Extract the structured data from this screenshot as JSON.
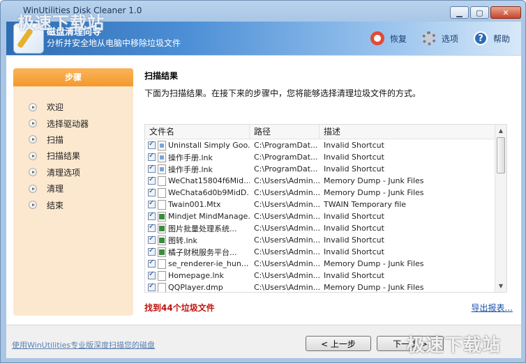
{
  "window": {
    "title": "WinUtilities Disk Cleaner 1.0"
  },
  "banner": {
    "title": "磁盘清理向导",
    "subtitle": "分析并安全地从电脑中移除垃圾文件",
    "actions": [
      {
        "label": "恢复",
        "icon": "lifebuoy-icon"
      },
      {
        "label": "选项",
        "icon": "gear-icon"
      },
      {
        "label": "帮助",
        "icon": "help-icon"
      }
    ]
  },
  "sidebar": {
    "title": "步骤",
    "steps": [
      "欢迎",
      "选择驱动器",
      "扫描",
      "扫描结果",
      "清理选项",
      "清理",
      "结束"
    ]
  },
  "main": {
    "title": "扫描结果",
    "description": "下面为扫描结果。在接下来的步骤中，您将能够选择清理垃圾文件的方式。",
    "columns": [
      "文件名",
      "路径",
      "描述"
    ],
    "rows": [
      [
        "Uninstall Simply Goo...",
        "C:\\ProgramDat...",
        "Invalid Shortcut"
      ],
      [
        "操作手册.lnk",
        "C:\\ProgramDat...",
        "Invalid Shortcut"
      ],
      [
        "操作手册.lnk",
        "C:\\ProgramDat...",
        "Invalid Shortcut"
      ],
      [
        "WeChat15804f6Mid...",
        "C:\\Users\\Admin...",
        "Memory Dump - Junk Files"
      ],
      [
        "WeChata6d0b9MidD...",
        "C:\\Users\\Admin...",
        "Memory Dump - Junk Files"
      ],
      [
        "Twain001.Mtx",
        "C:\\Users\\Admin...",
        "TWAIN Temporary file"
      ],
      [
        "Mindjet MindManage...",
        "C:\\Users\\Admin...",
        "Invalid Shortcut"
      ],
      [
        "图片批量处理系统...",
        "C:\\Users\\Admin...",
        "Invalid Shortcut"
      ],
      [
        "图转.lnk",
        "C:\\Users\\Admin...",
        "Invalid Shortcut"
      ],
      [
        "橘子财税服务平台...",
        "C:\\Users\\Admin...",
        "Invalid Shortcut"
      ],
      [
        "se_renderer-ie_hun...",
        "C:\\Users\\Admin...",
        "Memory Dump - Junk Files"
      ],
      [
        "Homepage.lnk",
        "C:\\Users\\Admin...",
        "Invalid Shortcut"
      ],
      [
        "QQPlayer.dmp",
        "C:\\Users\\Admin...",
        "Memory Dump - Junk Files"
      ]
    ],
    "found_text": "找到44个垃圾文件",
    "export_link": "导出报表..."
  },
  "footer": {
    "upgrade_link": "使用WinUtilities专业版深度扫描您的磁盘",
    "prev_button": "< 上一步",
    "next_button": "下一步 >"
  },
  "watermarks": {
    "top": "极速下载站",
    "bottom": "极速下载站"
  }
}
